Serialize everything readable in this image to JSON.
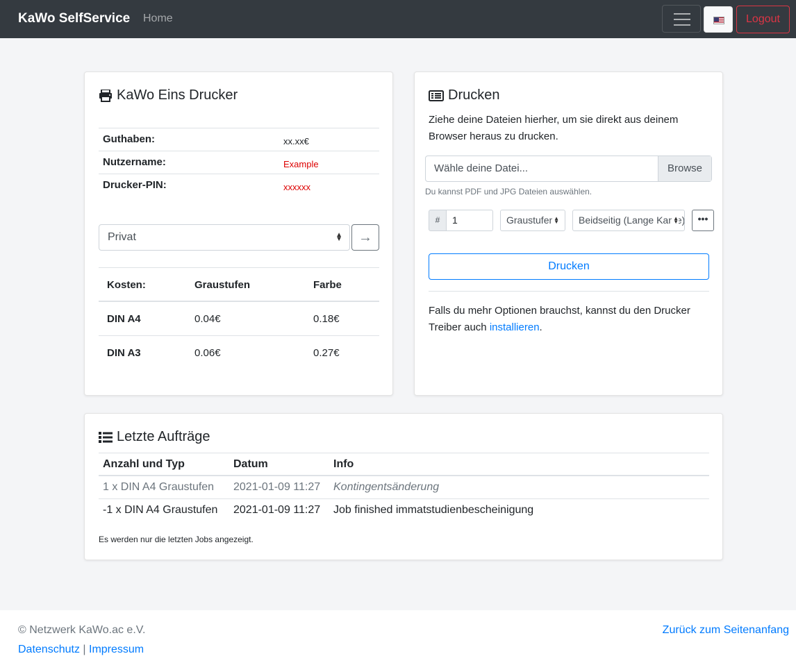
{
  "navbar": {
    "brand": "KaWo SelfService",
    "home": "Home",
    "logout": "Logout"
  },
  "printer_card": {
    "title": "KaWo Eins Drucker",
    "info": [
      {
        "label": "Guthaben:",
        "value": "xx.xx€"
      },
      {
        "label": "Nutzername:",
        "value": "Example"
      },
      {
        "label": "Drucker-PIN:",
        "value": "xxxxxx"
      }
    ],
    "account_select": "Privat",
    "costs": {
      "headers": [
        "Kosten:",
        "Graustufen",
        "Farbe"
      ],
      "rows": [
        [
          "DIN A4",
          "0.04€",
          "0.18€"
        ],
        [
          "DIN A3",
          "0.06€",
          "0.27€"
        ]
      ]
    }
  },
  "print_card": {
    "title": "Drucken",
    "description": "Ziehe deine Dateien hierher, um sie direkt aus deinem Browser heraus zu drucken.",
    "file_placeholder": "Wähle deine Datei...",
    "browse": "Browse",
    "file_hint": "Du kannst PDF und JPG Dateien auswählen.",
    "copies_prefix": "#",
    "copies": "1",
    "color_mode": "Graustufen",
    "duplex": "Beidseitig (Lange Kante)",
    "print_button": "Drucken",
    "driver_text_before": "Falls du mehr Optionen brauchst, kannst du den Drucker Treiber auch ",
    "driver_link": "installieren",
    "driver_text_after": "."
  },
  "orders_card": {
    "title": "Letzte Aufträge",
    "headers": [
      "Anzahl und Typ",
      "Datum",
      "Info"
    ],
    "rows": [
      [
        "1 x DIN A4 Graustufen",
        "2021-01-09 11:27",
        "Kontingentsänderung"
      ],
      [
        "-1 x DIN A4 Graustufen",
        "2021-01-09 11:27",
        "Job finished immatstudienbescheinigung"
      ]
    ],
    "note": "Es werden nur die letzten Jobs angezeigt."
  },
  "footer": {
    "copyright": "© Netzwerk KaWo.ac e.V.",
    "privacy": "Datenschutz",
    "separator": "|",
    "imprint": "Impressum",
    "back_to_top": "Zurück zum Seitenanfang"
  },
  "colors": {
    "navbar": "#343a40",
    "primary": "#007bff",
    "danger": "#dc3545",
    "secondary": "#6c757d"
  }
}
